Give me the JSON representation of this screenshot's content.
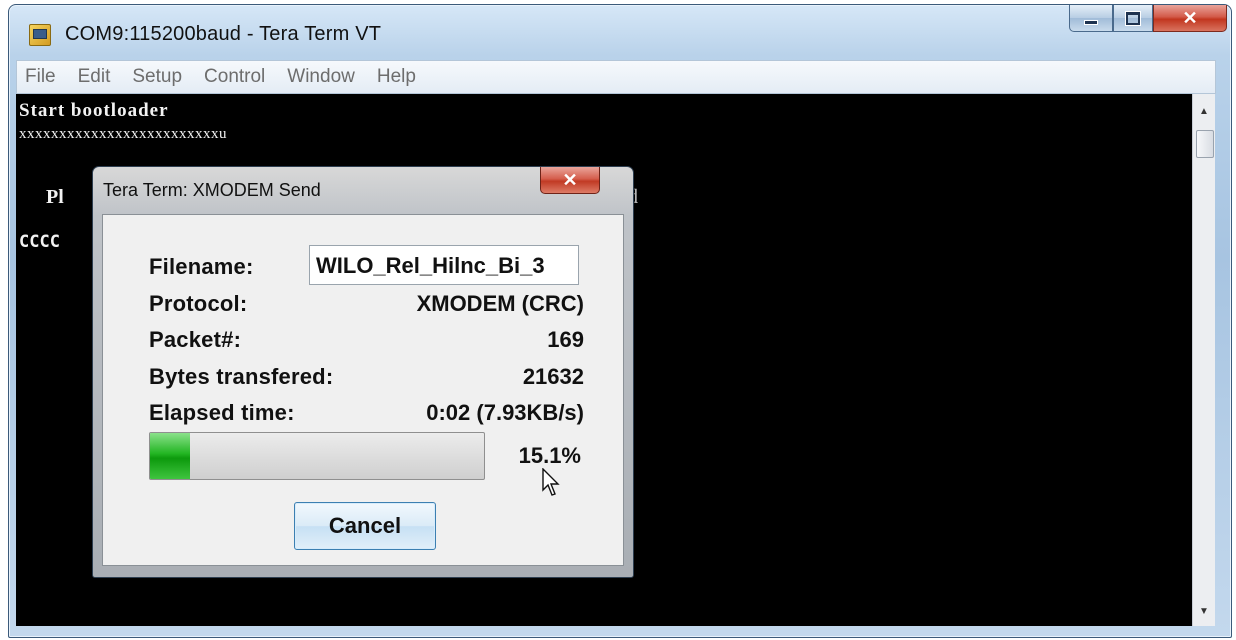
{
  "window": {
    "title": "COM9:115200baud - Tera Term VT",
    "caption_buttons": {
      "minimize": "minimize-icon",
      "maximize": "maximize-icon",
      "close": "✕"
    }
  },
  "menu": [
    "File",
    "Edit",
    "Setup",
    "Control",
    "Window",
    "Help"
  ],
  "terminal": {
    "line1": "Start bootloader",
    "line2": "xxxxxxxxxxxxxxxxxxxxxxxxxu",
    "line3_left": "Pl",
    "line3_right": "d",
    "line4": "CCCC"
  },
  "dialog": {
    "title": "Tera Term: XMODEM Send",
    "close_label": "✕",
    "filename_label": "Filename:",
    "filename_value": "WILO_Rel_Hilnc_Bi_3",
    "protocol_label": "Protocol:",
    "protocol_value": "XMODEM (CRC)",
    "packet_label": "Packet#:",
    "packet_value": "169",
    "bytes_label": "Bytes transfered:",
    "bytes_value": "21632",
    "elapsed_label": "Elapsed time:",
    "elapsed_value": "0:02 (7.93KB/s)",
    "progress_percent_text": "15.1%",
    "progress_fraction": 0.12,
    "cancel_label": "Cancel"
  },
  "colors": {
    "terminal_bg": "#000000",
    "terminal_fg": "#f2f2f2",
    "progress_green": "#22b522",
    "close_red": "#c13a24"
  }
}
